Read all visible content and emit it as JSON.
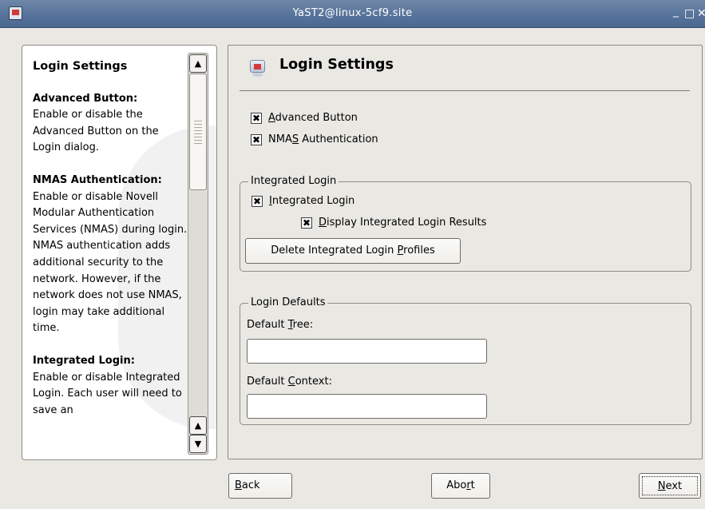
{
  "window": {
    "title": "YaST2@linux-5cf9.site",
    "min_glyph": "_",
    "max_glyph": "□",
    "close_glyph": "✕"
  },
  "help": {
    "title": "Login Settings",
    "sections": [
      {
        "heading": "Advanced Button:",
        "text": "Enable or disable the Advanced Button on the Login dialog."
      },
      {
        "heading": "NMAS Authentication:",
        "text": "Enable or disable Novell Modular Authentication Services (NMAS) during login. NMAS authentication adds additional security to the network. However, if the network does not use NMAS, login may take additional time."
      },
      {
        "heading": "Integrated Login:",
        "text": "Enable or disable Integrated Login. Each user will need to save an"
      }
    ],
    "scroll_up_glyph": "▲",
    "scroll_down_glyph": "▼"
  },
  "main": {
    "title": "Login Settings",
    "checkboxes": {
      "advanced_button": {
        "pre": "",
        "mn": "A",
        "post": "dvanced Button",
        "checked": true
      },
      "nmas": {
        "pre": "NMA",
        "mn": "S",
        "post": " Authentication",
        "checked": true
      }
    },
    "integrated_group": {
      "title": "Integrated Login",
      "integrated_login": {
        "pre": "",
        "mn": "I",
        "post": "ntegrated Login",
        "checked": true
      },
      "display_results": {
        "pre": "",
        "mn": "D",
        "post": "isplay Integrated Login Results",
        "checked": true
      },
      "delete_button": {
        "pre": "Delete Integrated Login ",
        "mn": "P",
        "post": "rofiles"
      }
    },
    "defaults_group": {
      "title": "Login Defaults",
      "tree_label": {
        "pre": "Default ",
        "mn": "T",
        "post": "ree:"
      },
      "tree_value": "",
      "context_label": {
        "pre": "Default ",
        "mn": "C",
        "post": "ontext:"
      },
      "context_value": ""
    },
    "check_glyph": "✖"
  },
  "buttons": {
    "back": {
      "pre": "",
      "mn": "B",
      "post": "ack"
    },
    "abort": {
      "pre": "Abo",
      "mn": "r",
      "post": "t"
    },
    "next": {
      "pre": "",
      "mn": "N",
      "post": "ext"
    }
  }
}
